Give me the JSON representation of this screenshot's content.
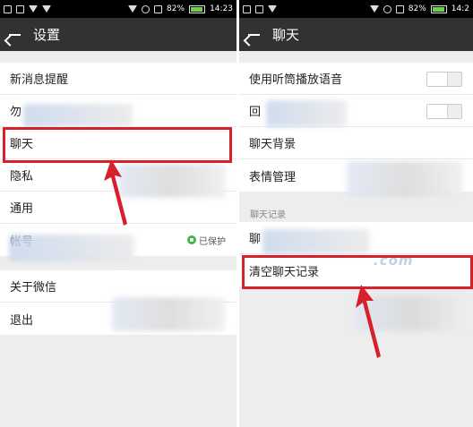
{
  "status_bar": {
    "battery": "82%",
    "time": "14:23",
    "time_right_partial": "14:2"
  },
  "left": {
    "title": "设置",
    "items": [
      {
        "label": "新消息提醒"
      },
      {
        "label": "勿"
      },
      {
        "label": "聊天"
      },
      {
        "label": "隐私"
      },
      {
        "label": "通用"
      },
      {
        "label": "帐号"
      },
      {
        "label": "关于微信"
      },
      {
        "label": "退出"
      }
    ],
    "account_status": "已保护"
  },
  "right": {
    "title": "聊天",
    "items": [
      {
        "label": "使用听筒播放语音"
      },
      {
        "label": "回"
      },
      {
        "label": "聊天背景"
      },
      {
        "label": "表情管理"
      }
    ],
    "section_label": "聊天记录",
    "history_items": [
      {
        "label": "聊"
      },
      {
        "label": "清空聊天记录"
      }
    ]
  },
  "watermark": ".com",
  "colors": {
    "highlight": "#d8202a",
    "titlebar": "#323232",
    "protected_icon": "#3dbb3d"
  }
}
